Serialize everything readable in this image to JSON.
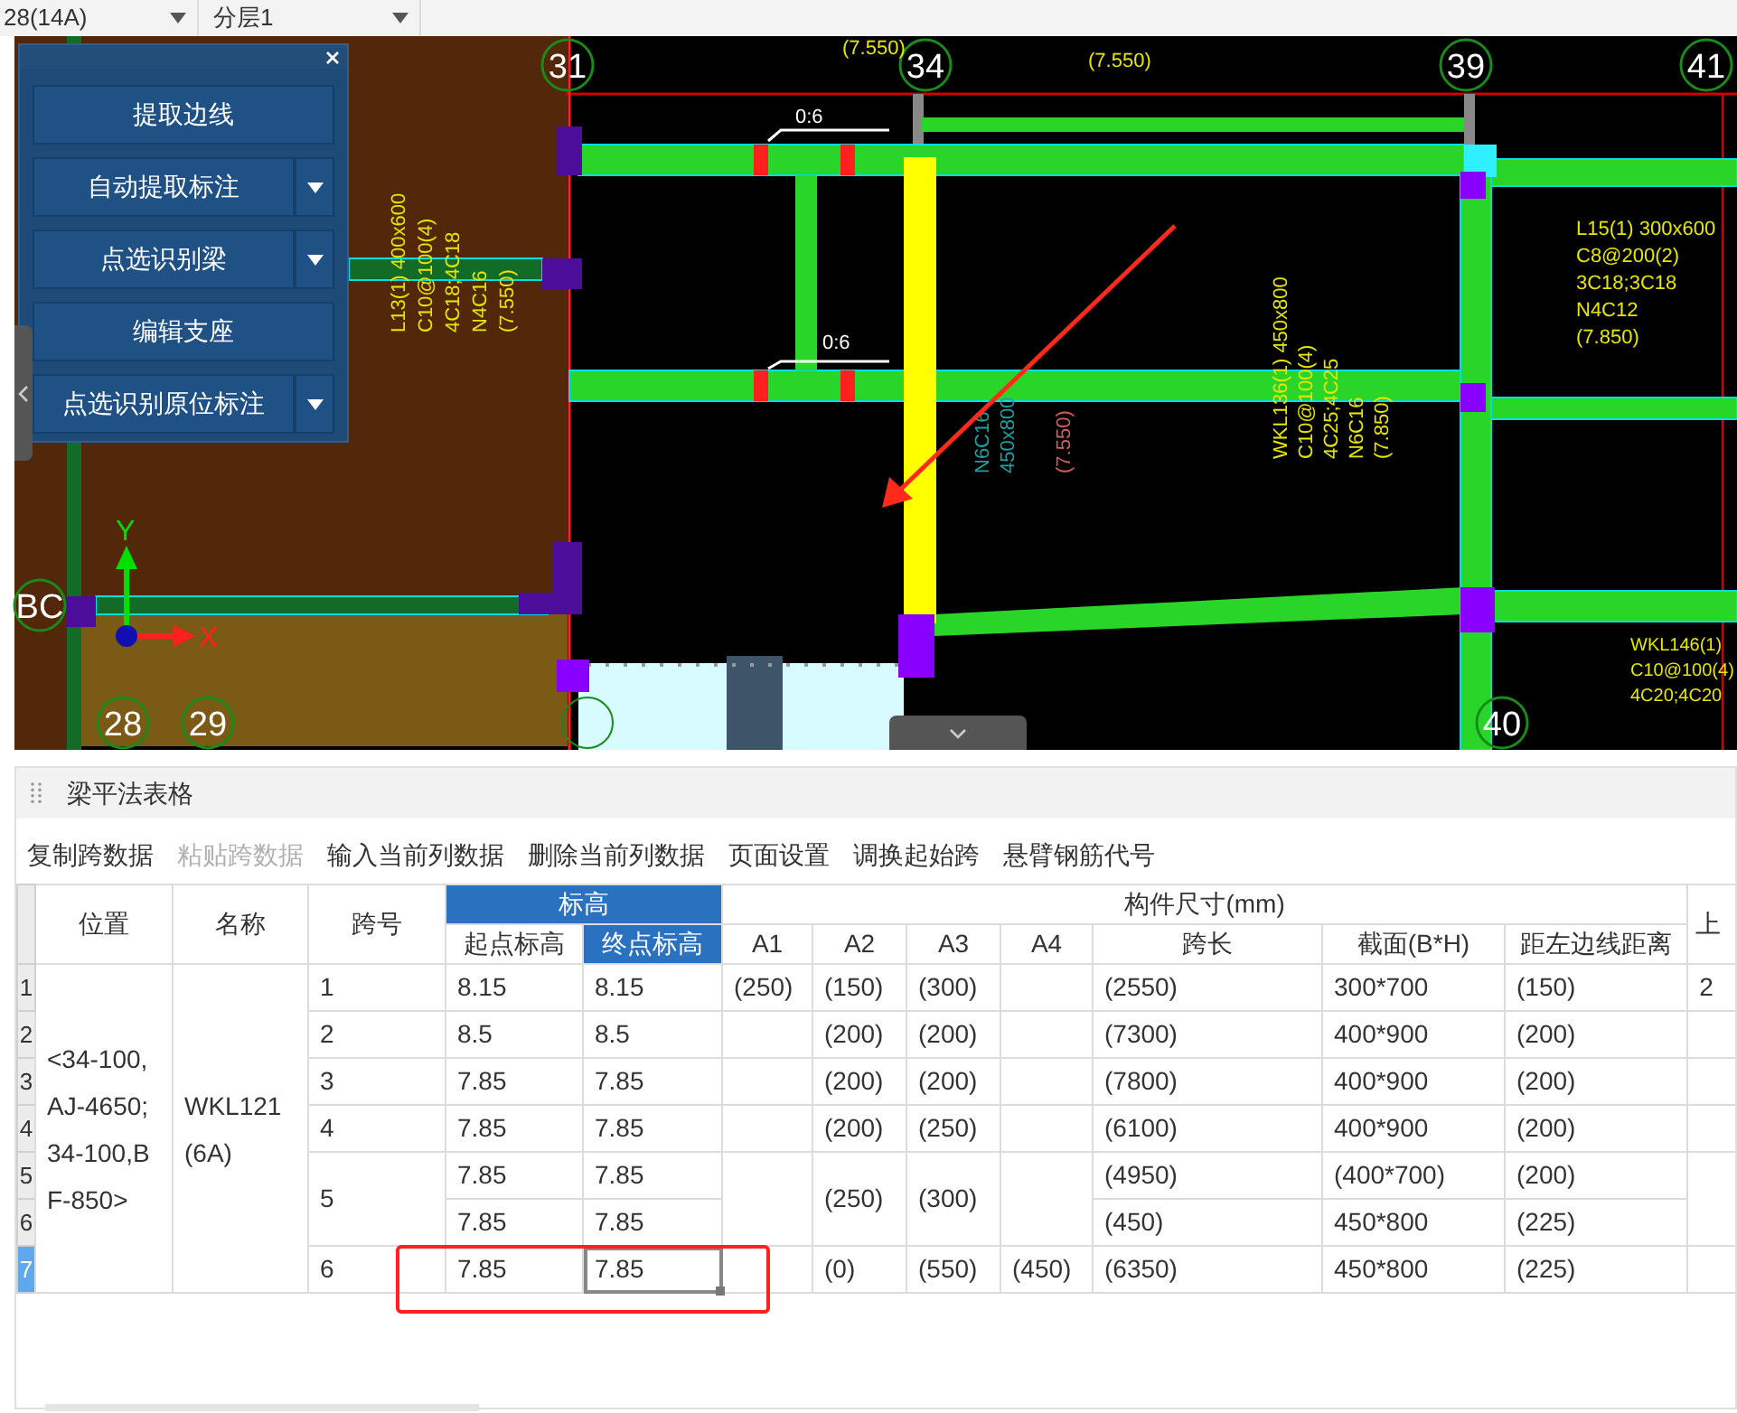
{
  "top_bar": {
    "dropdowns": [
      {
        "value": "28(14A)"
      },
      {
        "value": "分层1"
      }
    ]
  },
  "cad": {
    "grid_labels": [
      {
        "label": "31"
      },
      {
        "label": "34"
      },
      {
        "label": "39"
      },
      {
        "label": "41"
      },
      {
        "label": "28"
      },
      {
        "label": "29"
      },
      {
        "label": "BC"
      },
      {
        "label": "40"
      }
    ],
    "axis": {
      "x": "X",
      "y": "Y"
    },
    "annotations": [
      {
        "kind": "horizontal",
        "color": "#ffffff",
        "lines": [
          "0:6"
        ]
      },
      {
        "kind": "horizontal",
        "color": "#ffffff",
        "lines": [
          "0:6"
        ]
      },
      {
        "kind": "horizontal",
        "color": "#e6e600",
        "lines": [
          "(7.550)"
        ]
      },
      {
        "kind": "horizontal",
        "color": "#e6e600",
        "lines": [
          "(7.550)"
        ]
      },
      {
        "kind": "horizontal",
        "color": "#e6e600",
        "lines": [
          "L15(1) 300x600",
          "C8@200(2)",
          "3C18;3C18",
          "N4C12",
          "(7.850)"
        ]
      },
      {
        "kind": "horizontal",
        "color": "#e6e600",
        "lines": [
          "WKL146(1)",
          "C10@100(4)",
          "4C20;4C20"
        ]
      },
      {
        "kind": "vertical",
        "color": "#e6e600",
        "lines": [
          "WKL136(1) 450x800",
          "C10@100(4)",
          "4C25;4C25",
          "N6C16",
          "(7.850)"
        ]
      },
      {
        "kind": "vertical",
        "color": "#e6e600",
        "lines": [
          "L13(1) 400x600",
          "C10@100(4)",
          "4C18;4C18",
          "N4C16",
          "(7.550)"
        ]
      },
      {
        "kind": "vertical",
        "color": "#1fa0a0",
        "lines": [
          "N6C16",
          "450x800"
        ]
      },
      {
        "kind": "vertical",
        "color": "#d06060",
        "lines": [
          "(7.550)"
        ]
      }
    ]
  },
  "recognition_panel": {
    "buttons": [
      {
        "label": "提取边线",
        "has_menu": false
      },
      {
        "label": "自动提取标注",
        "has_menu": true
      },
      {
        "label": "点选识别梁",
        "has_menu": true
      },
      {
        "label": "编辑支座",
        "has_menu": false
      },
      {
        "label": "点选识别原位标注",
        "has_menu": true
      }
    ]
  },
  "table_panel": {
    "title": "梁平法表格",
    "toolbar": [
      {
        "label": "复制跨数据",
        "disabled": false
      },
      {
        "label": "粘贴跨数据",
        "disabled": true
      },
      {
        "label": "输入当前列数据",
        "disabled": false
      },
      {
        "label": "删除当前列数据",
        "disabled": false
      },
      {
        "label": "页面设置",
        "disabled": false
      },
      {
        "label": "调换起始跨",
        "disabled": false
      },
      {
        "label": "悬臂钢筋代号",
        "disabled": false
      }
    ],
    "header": {
      "position": "位置",
      "name": "名称",
      "span": "跨号",
      "elevation": {
        "label": "标高",
        "selected": true,
        "columns": [
          {
            "label": "起点标高",
            "selected": false
          },
          {
            "label": "终点标高",
            "selected": true
          }
        ]
      },
      "size": {
        "label": "构件尺寸(mm)",
        "columns": [
          "A1",
          "A2",
          "A3",
          "A4",
          "跨长",
          "截面(B*H)",
          "距左边线距离"
        ]
      },
      "column_14": "上"
    },
    "row_numbers": [
      {
        "label": "1",
        "selected": false
      },
      {
        "label": "2",
        "selected": false
      },
      {
        "label": "3",
        "selected": false
      },
      {
        "label": "4",
        "selected": false
      },
      {
        "label": "5",
        "selected": false
      },
      {
        "label": "6",
        "selected": false
      },
      {
        "label": "7",
        "selected": true
      }
    ],
    "beam": {
      "position": "<34-100,AJ-4650;34-100,BF-850>",
      "name": "WKL121(6A)"
    },
    "spans": [
      {
        "span": "1",
        "a1": "(250)",
        "a2": "(150)",
        "a3": "(300)",
        "column_14": "2",
        "segments": [
          {
            "start": "8.15",
            "end": "8.15",
            "length": "(2550)",
            "section": "300*700",
            "offset": "(150)",
            "focused": false
          }
        ]
      },
      {
        "span": "2",
        "a2": "(200)",
        "a3": "(200)",
        "segments": [
          {
            "start": "8.5",
            "end": "8.5",
            "length": "(7300)",
            "section": "400*900",
            "offset": "(200)",
            "focused": false
          }
        ]
      },
      {
        "span": "3",
        "a2": "(200)",
        "a3": "(200)",
        "segments": [
          {
            "start": "7.85",
            "end": "7.85",
            "length": "(7800)",
            "section": "400*900",
            "offset": "(200)",
            "focused": false
          }
        ]
      },
      {
        "span": "4",
        "a2": "(200)",
        "a3": "(250)",
        "segments": [
          {
            "start": "7.85",
            "end": "7.85",
            "length": "(6100)",
            "section": "400*900",
            "offset": "(200)",
            "focused": false
          }
        ]
      },
      {
        "span": "5",
        "a2": "(250)",
        "a3": "(300)",
        "segments": [
          {
            "start": "7.85",
            "end": "7.85",
            "length": "(4950)",
            "section": "(400*700)",
            "offset": "(200)",
            "focused": false
          },
          {
            "start": "7.85",
            "end": "7.85",
            "length": "(450)",
            "section": "450*800",
            "offset": "(225)",
            "focused": false
          }
        ]
      },
      {
        "span": "6",
        "a2": "(0)",
        "a3": "(550)",
        "a4": "(450)",
        "segments": [
          {
            "start": "7.85",
            "end": "7.85",
            "length": "(6350)",
            "section": "450*800",
            "offset": "(225)",
            "focused": true
          }
        ]
      }
    ]
  }
}
